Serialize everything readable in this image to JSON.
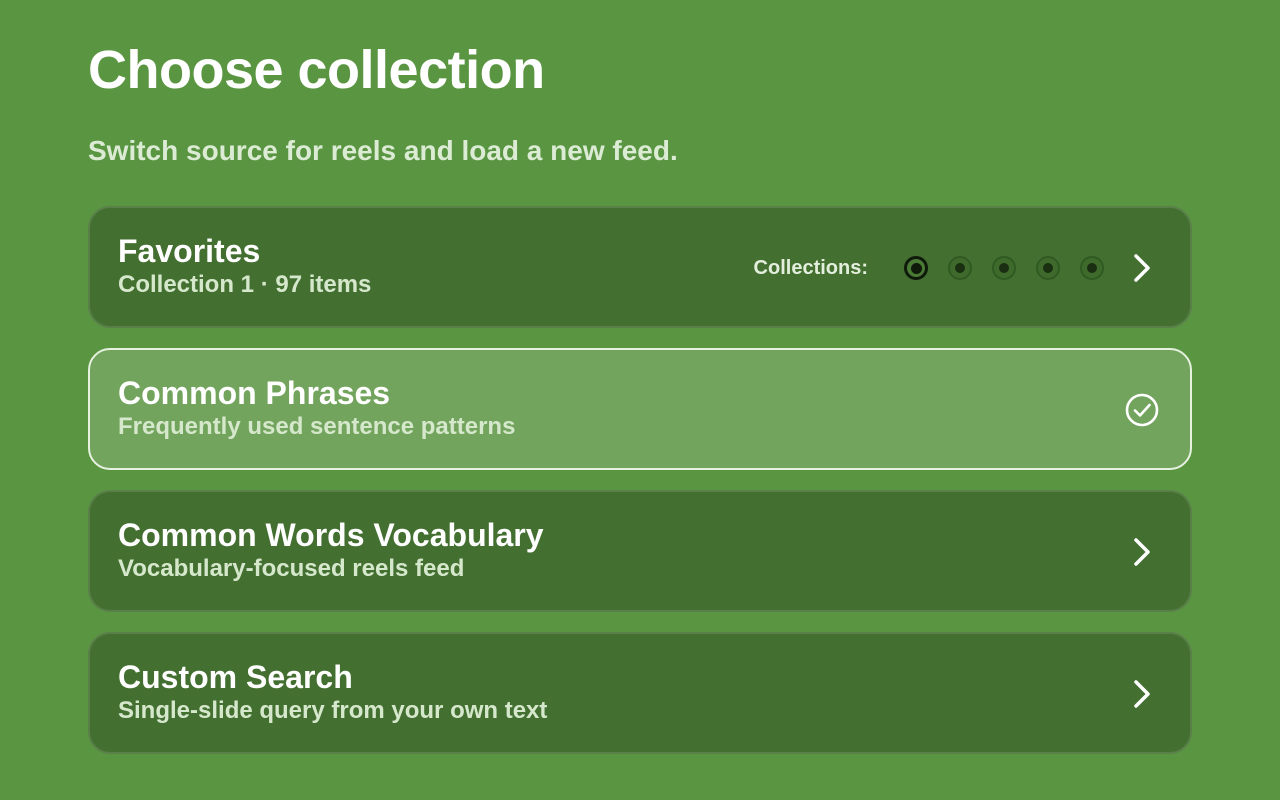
{
  "header": {
    "title": "Choose collection",
    "subtitle": "Switch source for reels and load a new feed."
  },
  "cards": [
    {
      "title": "Favorites",
      "subtitle": "Collection 1 · 97 items",
      "collections_label": "Collections:",
      "collections_count": 5,
      "active_collection": 1,
      "trailing_icon": "chevron-right-icon",
      "selected": false
    },
    {
      "title": "Common Phrases",
      "subtitle": "Frequently used sentence patterns",
      "trailing_icon": "check-circle-icon",
      "selected": true
    },
    {
      "title": "Common Words Vocabulary",
      "subtitle": "Vocabulary-focused reels feed",
      "trailing_icon": "chevron-right-icon",
      "selected": false
    },
    {
      "title": "Custom Search",
      "subtitle": "Single-slide query from your own text",
      "trailing_icon": "chevron-right-icon",
      "selected": false
    }
  ],
  "colors": {
    "background": "#5a9642",
    "card": "#436f30",
    "card_selected": "#72a45d",
    "text_primary": "#ffffff",
    "text_secondary": "#d6e8cc"
  }
}
